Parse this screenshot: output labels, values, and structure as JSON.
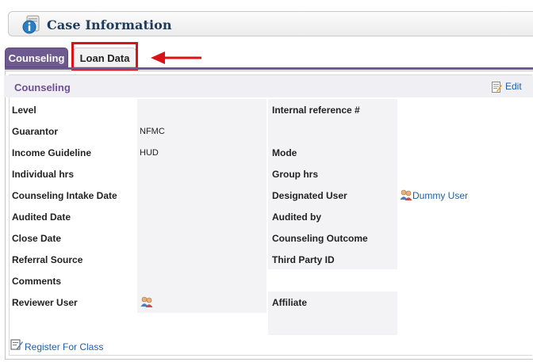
{
  "header": {
    "title": "Case Information"
  },
  "tabs": [
    {
      "label": "Counseling",
      "active": true
    },
    {
      "label": "Loan Data",
      "active": false
    }
  ],
  "panel": {
    "title": "Counseling",
    "edit_label": "Edit",
    "register_label": "Register For Class"
  },
  "fields": {
    "level": {
      "label": "Level",
      "value": ""
    },
    "internal_ref": {
      "label": "Internal reference #",
      "value": ""
    },
    "guarantor": {
      "label": "Guarantor",
      "value": "NFMC"
    },
    "income_guideline": {
      "label": "Income Guideline",
      "value": "HUD"
    },
    "mode": {
      "label": "Mode",
      "value": ""
    },
    "individual_hrs": {
      "label": "Individual hrs",
      "value": ""
    },
    "group_hrs": {
      "label": "Group hrs",
      "value": ""
    },
    "intake_date": {
      "label": "Counseling Intake Date",
      "value": ""
    },
    "designated_user": {
      "label": "Designated User",
      "value": "Dummy User"
    },
    "audited_date": {
      "label": "Audited Date",
      "value": ""
    },
    "audited_by": {
      "label": "Audited by",
      "value": ""
    },
    "close_date": {
      "label": "Close Date",
      "value": ""
    },
    "outcome": {
      "label": "Counseling Outcome",
      "value": ""
    },
    "referral_source": {
      "label": "Referral Source",
      "value": ""
    },
    "third_party_id": {
      "label": "Third Party ID",
      "value": ""
    },
    "comments": {
      "label": "Comments",
      "value": ""
    },
    "reviewer_user": {
      "label": "Reviewer User",
      "value": ""
    },
    "affiliate": {
      "label": "Affiliate",
      "value": ""
    }
  },
  "colors": {
    "accent_purple": "#6e5a8e",
    "highlight_red": "#d8141a",
    "link_blue": "#1f5ea8"
  },
  "icons": [
    "info-icon",
    "edit-icon",
    "user-group-icon",
    "register-icon",
    "arrow-annotation"
  ]
}
